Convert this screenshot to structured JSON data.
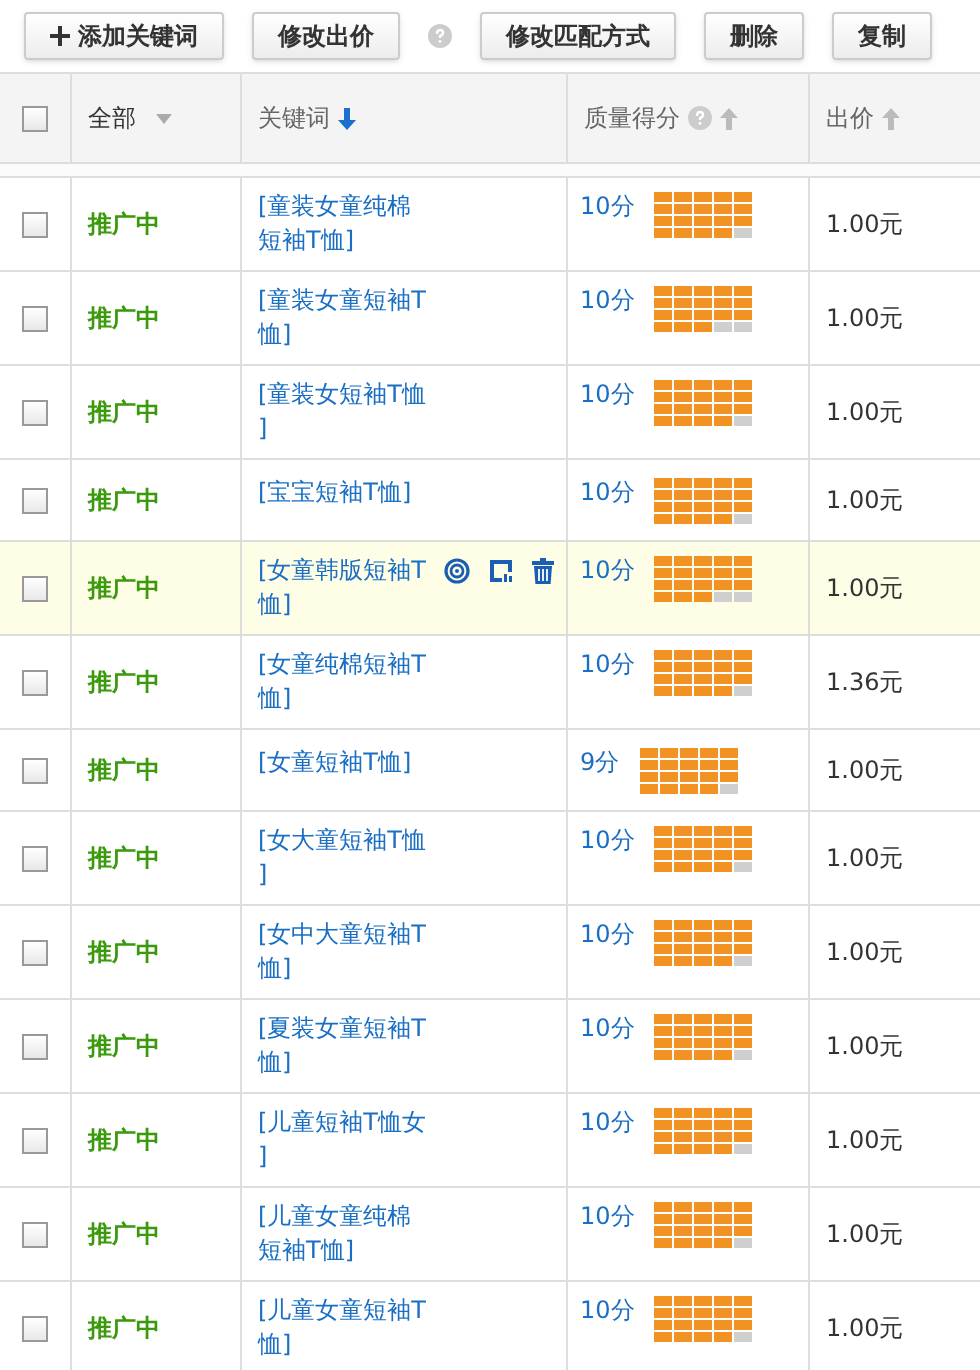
{
  "toolbar": {
    "buttons": [
      {
        "label": "添加关键词",
        "kind": "add"
      },
      {
        "label": "修改出价",
        "kind": "help"
      },
      {
        "label": "修改匹配方式",
        "kind": "plain"
      },
      {
        "label": "删除",
        "kind": "plain"
      },
      {
        "label": "复制",
        "kind": "plain"
      }
    ]
  },
  "table": {
    "select_all": {
      "checked": false
    },
    "columns": [
      {
        "label": "全部",
        "kind": "filter"
      },
      {
        "label": "关键词",
        "kind": "sort",
        "descending": true,
        "active": true
      },
      {
        "label": "质量得分",
        "kind": "sort_help",
        "descending": false,
        "active": false
      },
      {
        "label": "出价",
        "kind": "sort",
        "descending": false,
        "active": false
      }
    ],
    "rows": [
      {
        "checked": false,
        "status": "推广中",
        "keyword_lines": [
          "[童装女童纯棉",
          "短袖T恤]"
        ],
        "score": "10分",
        "level": 0.95,
        "price": "1.00元",
        "highlighted": false
      },
      {
        "checked": false,
        "status": "推广中",
        "keyword_lines": [
          "[童装女童短袖T",
          "恤]"
        ],
        "score": "10分",
        "level": 0.9,
        "price": "1.00元",
        "highlighted": false
      },
      {
        "checked": false,
        "status": "推广中",
        "keyword_lines": [
          "[童装女短袖T恤",
          "]"
        ],
        "score": "10分",
        "level": 0.95,
        "price": "1.00元",
        "highlighted": false
      },
      {
        "checked": false,
        "status": "推广中",
        "keyword_lines": [
          "[宝宝短袖T恤]"
        ],
        "score": "10分",
        "level": 0.95,
        "price": "1.00元",
        "highlighted": false
      },
      {
        "checked": false,
        "status": "推广中",
        "keyword_lines": [
          "[女童韩版短袖T",
          "恤]"
        ],
        "score": "10分",
        "level": 0.9,
        "price": "1.00元",
        "highlighted": true
      },
      {
        "checked": false,
        "status": "推广中",
        "keyword_lines": [
          "[女童纯棉短袖T",
          "恤]"
        ],
        "score": "10分",
        "level": 0.95,
        "price": "1.36元",
        "highlighted": false
      },
      {
        "checked": false,
        "status": "推广中",
        "keyword_lines": [
          "[女童短袖T恤]"
        ],
        "score": "9分",
        "level": 0.95,
        "price": "1.00元",
        "highlighted": false
      },
      {
        "checked": false,
        "status": "推广中",
        "keyword_lines": [
          "[女大童短袖T恤",
          "]"
        ],
        "score": "10分",
        "level": 0.95,
        "price": "1.00元",
        "highlighted": false
      },
      {
        "checked": false,
        "status": "推广中",
        "keyword_lines": [
          "[女中大童短袖T",
          "恤]"
        ],
        "score": "10分",
        "level": 0.95,
        "price": "1.00元",
        "highlighted": false
      },
      {
        "checked": false,
        "status": "推广中",
        "keyword_lines": [
          "[夏装女童短袖T",
          "恤]"
        ],
        "score": "10分",
        "level": 0.95,
        "price": "1.00元",
        "highlighted": false
      },
      {
        "checked": false,
        "status": "推广中",
        "keyword_lines": [
          "[儿童短袖T恤女",
          "]"
        ],
        "score": "10分",
        "level": 0.95,
        "price": "1.00元",
        "highlighted": false
      },
      {
        "checked": false,
        "status": "推广中",
        "keyword_lines": [
          "[儿童女童纯棉",
          "短袖T恤]"
        ],
        "score": "10分",
        "level": 0.95,
        "price": "1.00元",
        "highlighted": false
      },
      {
        "checked": false,
        "status": "推广中",
        "keyword_lines": [
          "[儿童女童短袖T",
          "恤]"
        ],
        "score": "10分",
        "level": 0.95,
        "price": "1.00元",
        "highlighted": false
      }
    ]
  }
}
